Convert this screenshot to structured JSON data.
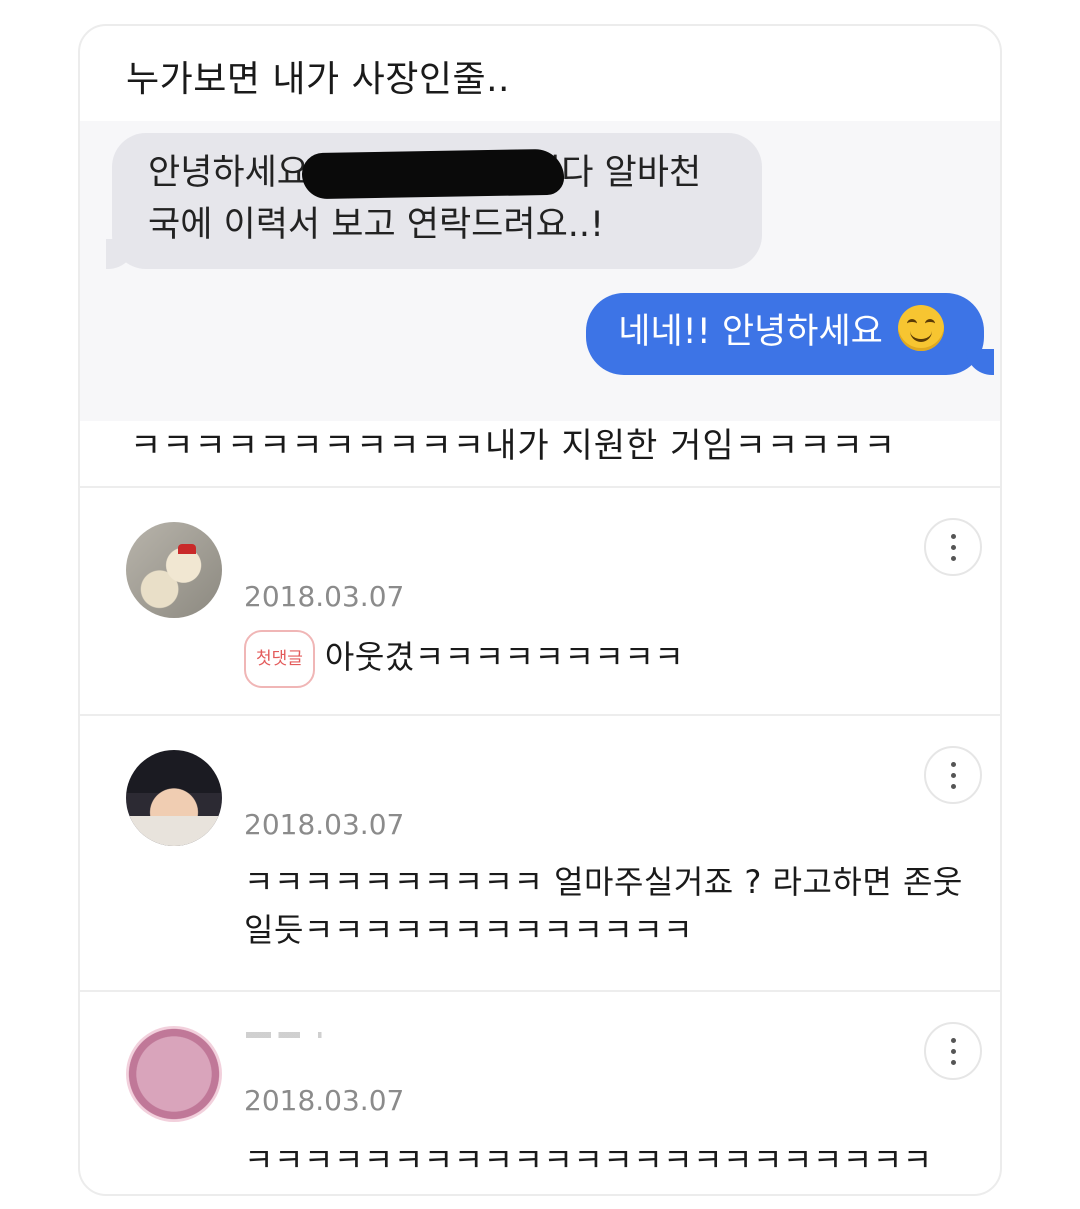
{
  "post": {
    "title": "누가보면 내가 사장인줄..",
    "incoming_line1_start": "안녕하세요",
    "incoming_line1_end": "니다 알바천",
    "incoming_line2": "국에 이력서 보고 연락드려요..!",
    "outgoing_text": "네네!! 안녕하세요",
    "caption": "ㅋㅋㅋㅋㅋㅋㅋㅋㅋㅋㅋ내가 지원한 거임ㅋㅋㅋㅋㅋ"
  },
  "comments": [
    {
      "date": "2018.03.07",
      "badge": "첫댓글",
      "text": "아웃겼ㅋㅋㅋㅋㅋㅋㅋㅋㅋ",
      "avatar": "hamster-avatar"
    },
    {
      "date": "2018.03.07",
      "text_line1": "ㅋㅋㅋㅋㅋㅋㅋㅋㅋㅋ 얼마주실거죠 ? 라고하면 존웃",
      "text_line2": "일듯ㅋㅋㅋㅋㅋㅋㅋㅋㅋㅋㅋㅋㅋ",
      "avatar": "person-avatar"
    },
    {
      "date": "2018.03.07",
      "text": "ㅋㅋㅋㅋㅋㅋㅋㅋㅋㅋㅋㅋㅋㅋㅋㅋㅋㅋㅋㅋㅋㅋㅋ",
      "avatar": "pink-avatar"
    }
  ],
  "icons": {
    "more": "more-vertical-icon",
    "emoji": "smiling-face-emoji"
  },
  "colors": {
    "outgoing_bubble": "#3d74e6",
    "incoming_bubble": "#e6e6eb",
    "badge": "#e35b5b",
    "date": "#8b8b8b"
  }
}
